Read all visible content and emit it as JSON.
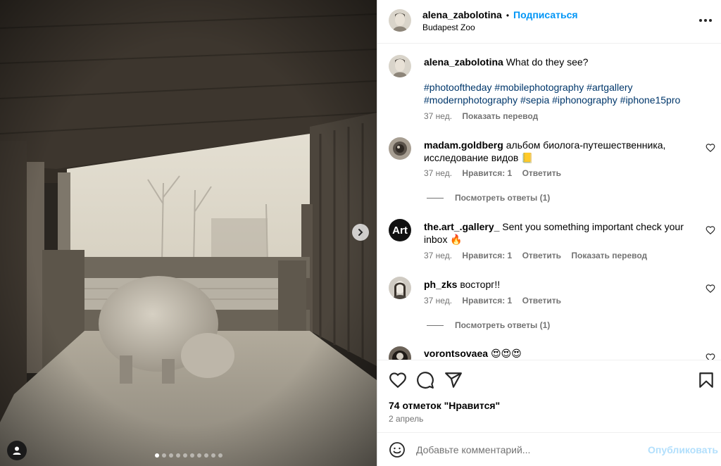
{
  "post": {
    "author": "alena_zabolotina",
    "separator": "•",
    "follow_label": "Подписаться",
    "location": "Budapest Zoo",
    "caption": {
      "username": "alena_zabolotina",
      "text": "What do they see?",
      "hashtags_line1": "#photooftheday #mobilephotography #artgallery",
      "hashtags_line2": "#modernphotography #sepia #iphonography #iphone15pro",
      "time": "37 нед.",
      "translate": "Показать перевод"
    },
    "carousel": {
      "total_slides": 10,
      "active_slide": 1
    }
  },
  "comments": [
    {
      "username": "madam.goldberg",
      "text": "альбом биолога-путешественника, исследование видов 📒",
      "time": "37 нед.",
      "likes": "Нравится: 1",
      "reply": "Ответить",
      "view_replies": "Посмотреть ответы (1)"
    },
    {
      "username": "the.art_.gallery_",
      "text": "Sent you something important check your inbox 🔥",
      "time": "37 нед.",
      "likes": "Нравится: 1",
      "reply": "Ответить",
      "translate": "Показать перевод",
      "avatar_text": "Art"
    },
    {
      "username": "ph_zks",
      "text": "восторг!!",
      "time": "37 нед.",
      "likes": "Нравится: 1",
      "reply": "Ответить",
      "view_replies": "Посмотреть ответы (1)"
    },
    {
      "username": "vorontsovaea",
      "text": "😍😍😍"
    }
  ],
  "footer": {
    "likes_count": "74 отметок \"Нравится\"",
    "date": "2 апрель",
    "comment_placeholder": "Добавьте комментарий...",
    "publish_label": "Опубликовать"
  },
  "icons": {
    "more": "more-horizontal-icon",
    "like": "heart-icon",
    "comment": "comment-bubble-icon",
    "share": "paper-plane-icon",
    "save": "bookmark-icon",
    "emoji": "smiley-icon",
    "next": "chevron-right-icon",
    "tagged": "user-tag-icon"
  },
  "colors": {
    "accent": "#0095f6",
    "hashtag": "#00376b",
    "muted": "#737373",
    "publish_disabled": "#b2dffc"
  }
}
